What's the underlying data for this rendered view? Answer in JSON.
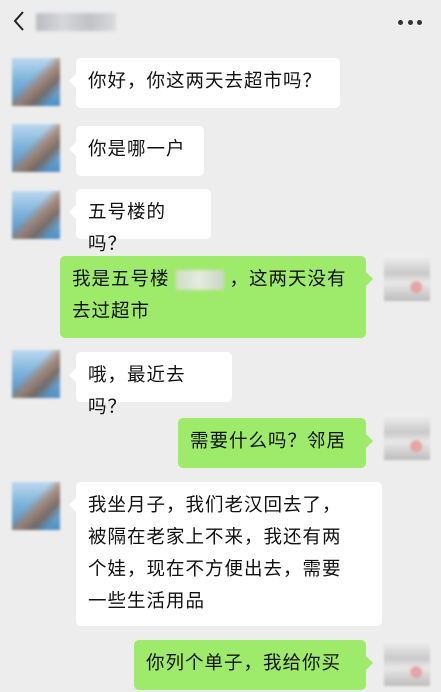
{
  "header": {
    "contact_name": "",
    "back_icon": "chevron-left-icon",
    "more_icon": "more-dots-icon"
  },
  "messages": [
    {
      "side": "left",
      "text": "你好，你这两天去超市吗？"
    },
    {
      "side": "left",
      "text": "你是哪一户"
    },
    {
      "side": "left",
      "text": "五号楼的吗？"
    },
    {
      "side": "right",
      "text_before": "我是五号楼",
      "text_after": "，这两天没有",
      "line2": "去过超市"
    },
    {
      "side": "left",
      "text": "哦，最近去吗？"
    },
    {
      "side": "right",
      "text": "需要什么吗？邻居"
    },
    {
      "side": "left",
      "lines": [
        "我坐月子，我们老汉回去了，",
        "被隔在老家上不来，我还有两",
        "个娃，现在不方便出去，需要",
        "一些生活用品"
      ]
    },
    {
      "side": "right",
      "text": "你列个单子，我给你买"
    }
  ],
  "colors": {
    "background": "#ededed",
    "bubble_left": "#ffffff",
    "bubble_right": "#9eea6a"
  }
}
